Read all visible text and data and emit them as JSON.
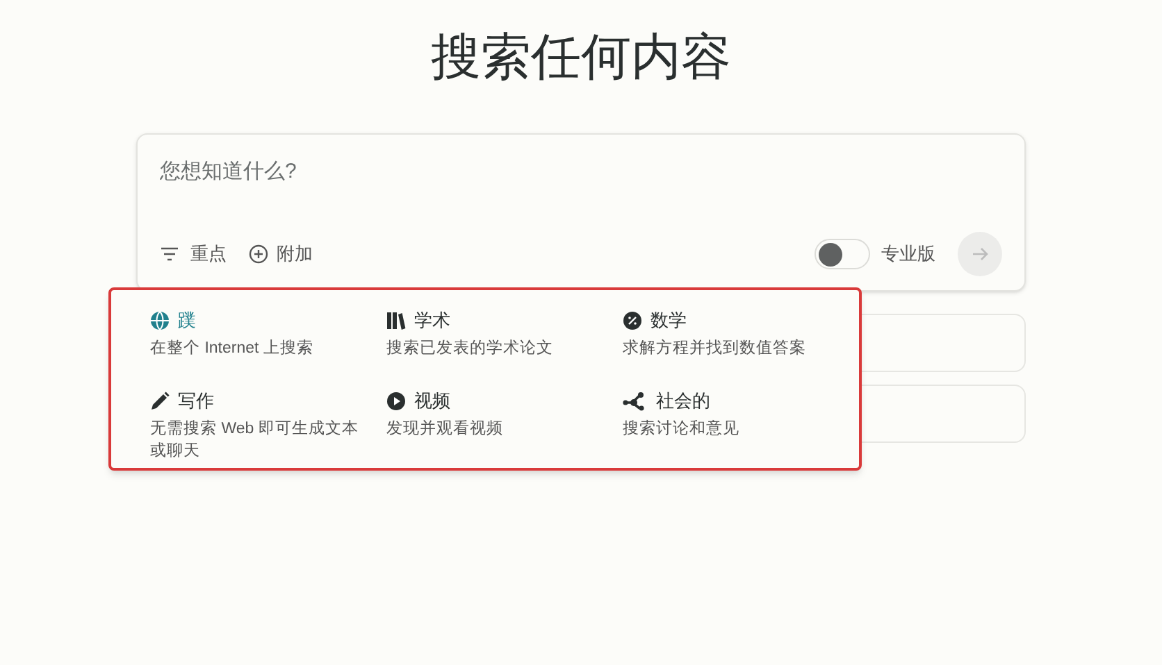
{
  "title": "搜索任何内容",
  "search": {
    "placeholder": "您想知道什么?",
    "focus_label": "重点",
    "attach_label": "附加",
    "pro": {
      "label": "专业版",
      "on": false
    }
  },
  "focus_menu": {
    "options": [
      {
        "kind": "globe",
        "label": "蹼",
        "description": "在整个 Internet 上搜索",
        "selected": true
      },
      {
        "kind": "books",
        "label": "学术",
        "description": "搜索已发表的学术论文",
        "selected": false
      },
      {
        "kind": "math",
        "label": "数学",
        "description": "求解方程并找到数值答案",
        "selected": false
      },
      {
        "kind": "pencil",
        "label": "写作",
        "description": "无需搜索 Web 即可生成文本或聊天",
        "selected": false
      },
      {
        "kind": "play",
        "label": "视频",
        "description": "发现并观看视频",
        "selected": false
      },
      {
        "kind": "network",
        "label": "社会的",
        "description": "搜索讨论和意见",
        "selected": false
      }
    ]
  }
}
